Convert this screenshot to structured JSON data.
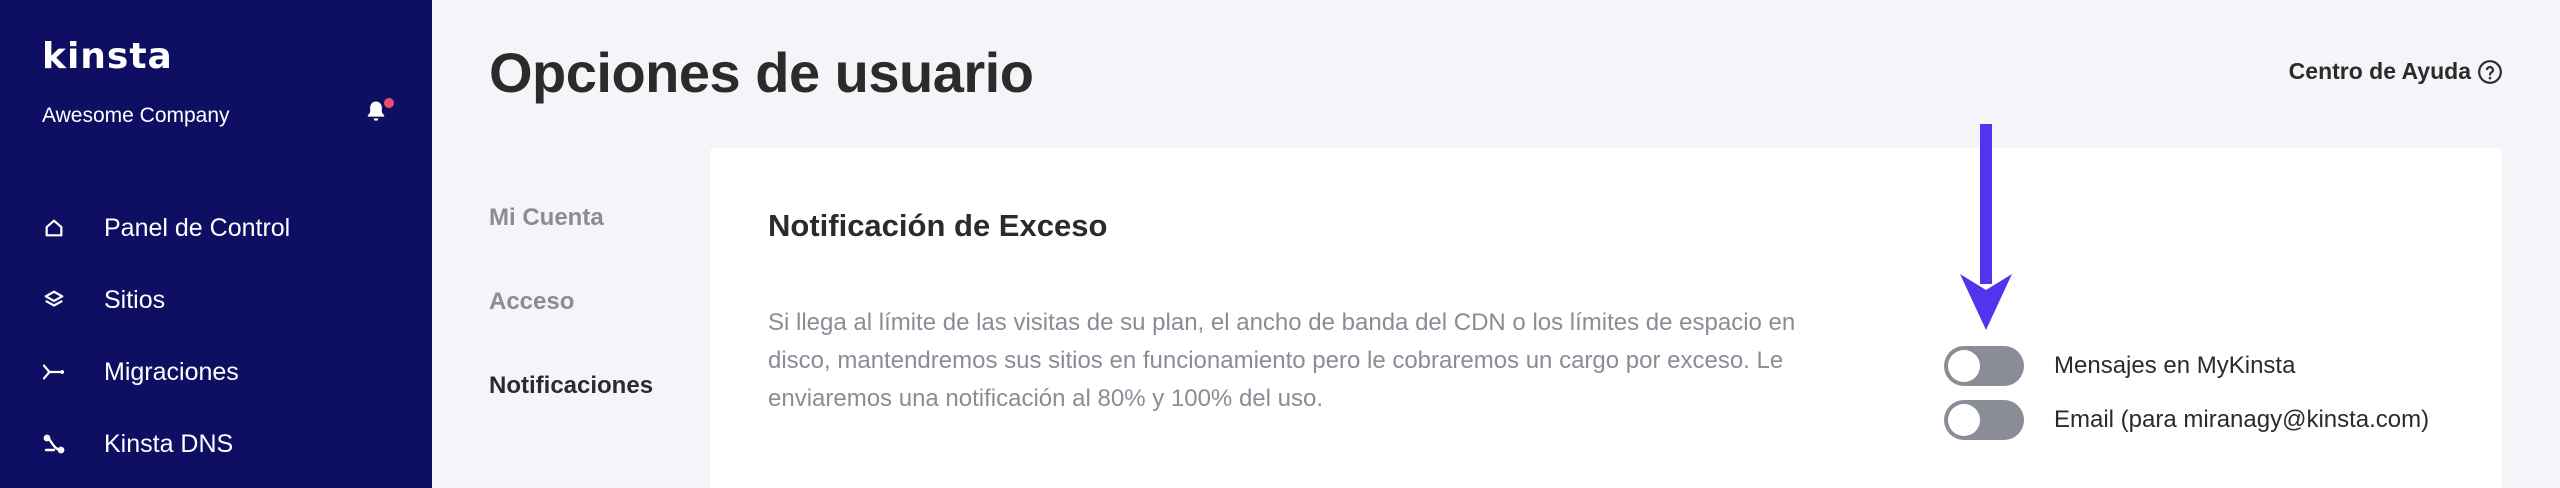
{
  "sidebar": {
    "logo": "kinsta",
    "company": "Awesome Company",
    "bell_icon": "bell-icon",
    "items": [
      {
        "label": "Panel de Control",
        "icon": "home-icon"
      },
      {
        "label": "Sitios",
        "icon": "layers-icon"
      },
      {
        "label": "Migraciones",
        "icon": "migration-icon"
      },
      {
        "label": "Kinsta DNS",
        "icon": "dns-icon"
      }
    ]
  },
  "header": {
    "title": "Opciones de usuario",
    "help_label": "Centro de Ayuda",
    "help_icon": "question-circle-icon"
  },
  "subnav": {
    "items": [
      {
        "label": "Mi Cuenta"
      },
      {
        "label": "Acceso"
      },
      {
        "label": "Notificaciones"
      }
    ]
  },
  "card": {
    "title": "Notificación de Exceso",
    "description": "Si llega al límite de las visitas de su plan, el ancho de banda del CDN o los límites de espacio en disco, mantendremos sus sitios en funcionamiento pero le cobraremos un cargo por exceso. Le enviaremos una notificación al 80% y 100% del uso.",
    "toggles": [
      {
        "label": "Mensajes en MyKinsta",
        "on": false
      },
      {
        "label": "Email (para miranagy@kinsta.com)",
        "on": false
      }
    ]
  },
  "colors": {
    "sidebar_bg": "#0e0f63",
    "page_bg": "#f5f5f9",
    "arrow": "#5333ed",
    "notification_dot": "#ef4b6d",
    "toggle_off": "#8a8c96"
  }
}
